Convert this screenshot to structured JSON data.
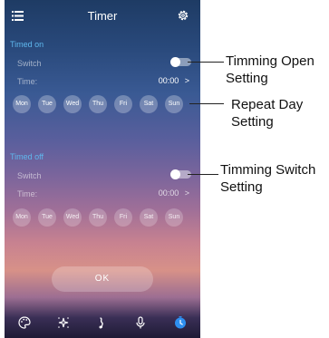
{
  "header": {
    "title": "Timer",
    "menu_icon": "menu-icon",
    "settings_icon": "gear-icon"
  },
  "timed_on": {
    "section_title": "Timed on",
    "switch_label": "Switch",
    "switch_state": "off",
    "time_label": "Time:",
    "time_value": "00:00",
    "chevron": ">",
    "days": [
      "Mon",
      "Tue",
      "Wed",
      "Thu",
      "Fri",
      "Sat",
      "Sun"
    ]
  },
  "timed_off": {
    "section_title": "Timed off",
    "switch_label": "Switch",
    "switch_state": "off",
    "time_label": "Time:",
    "time_value": "00:00",
    "chevron": ">",
    "days": [
      "Mon",
      "Tue",
      "Wed",
      "Thu",
      "Fri",
      "Sat",
      "Sun"
    ]
  },
  "ok_label": "OK",
  "bottom_nav": [
    "palette-icon",
    "sparkle-icon",
    "music-note-icon",
    "microphone-icon",
    "timer-icon"
  ],
  "active_nav": "timer-icon",
  "colors": {
    "accent": "#5fb8ee",
    "active_nav": "#2e8ff0"
  },
  "callouts": {
    "timing_open": [
      "Timming Open",
      "Setting"
    ],
    "repeat_day": [
      "Repeat Day",
      "Setting"
    ],
    "timing_switch": [
      "Timming Switch",
      "Setting"
    ]
  }
}
